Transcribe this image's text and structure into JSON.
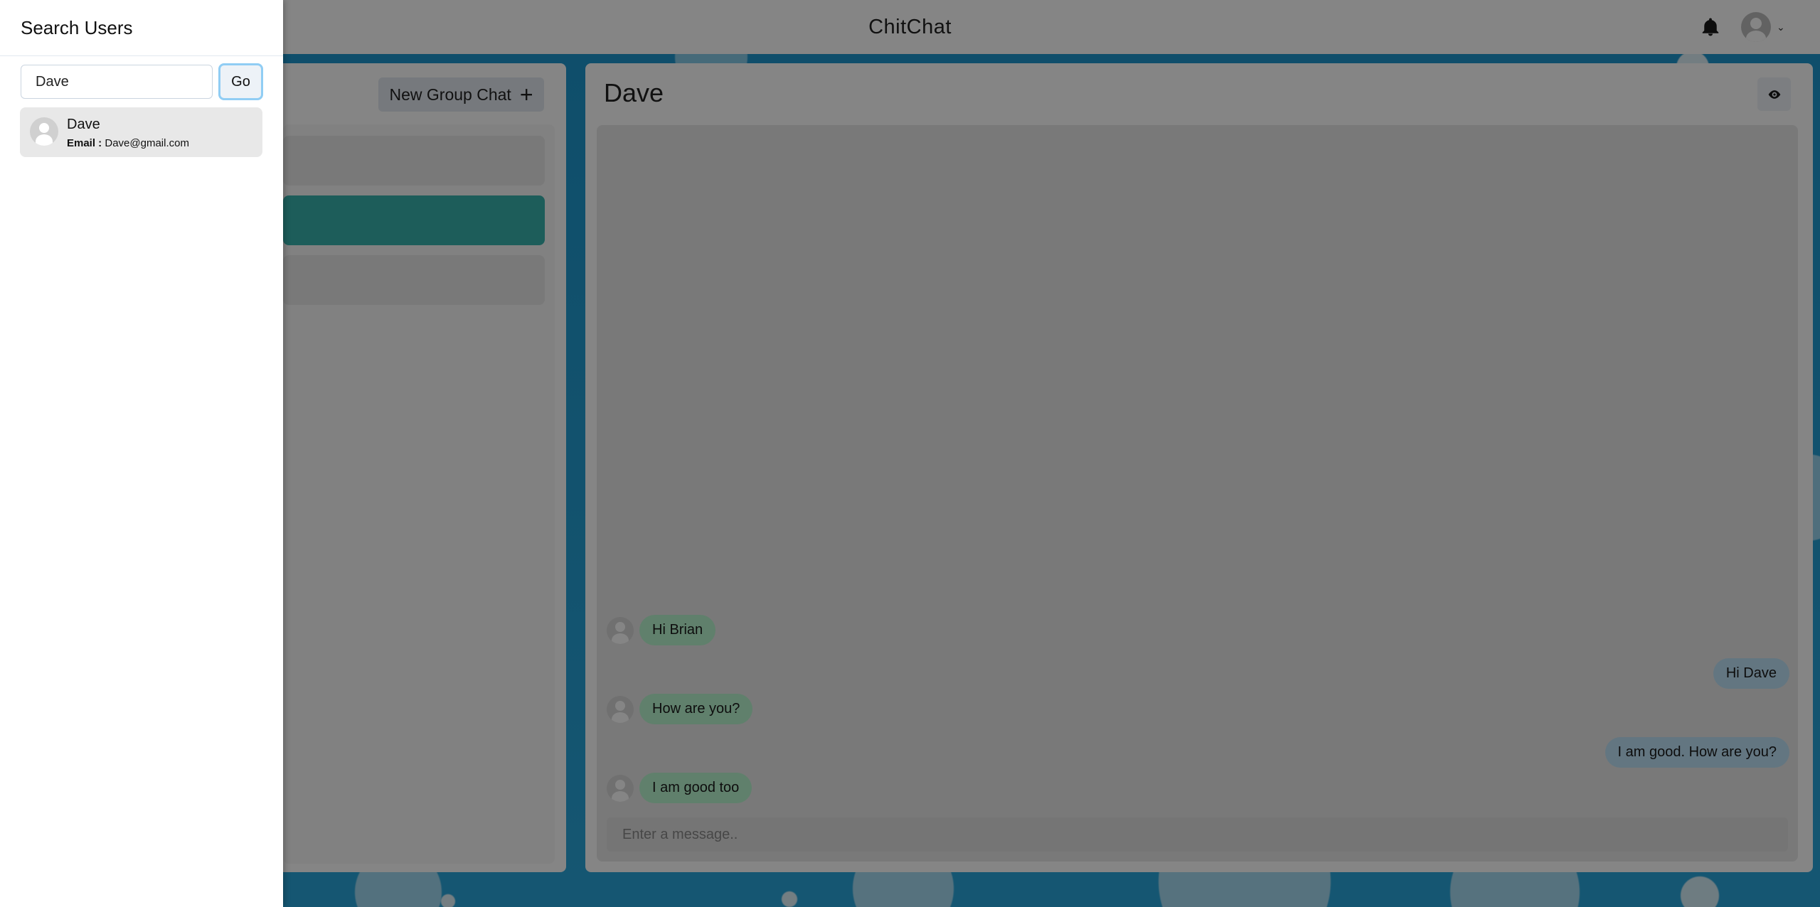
{
  "header": {
    "title": "ChitChat"
  },
  "chats": {
    "new_group_label": "New Group Chat",
    "new_group_icon": "+"
  },
  "conversation": {
    "title": "Dave",
    "messages": [
      {
        "text": "Hi Brian",
        "direction": "in"
      },
      {
        "text": "Hi Dave",
        "direction": "out"
      },
      {
        "text": "How are you?",
        "direction": "in"
      },
      {
        "text": "I am good. How are you?",
        "direction": "out"
      },
      {
        "text": "I am good too",
        "direction": "in"
      }
    ],
    "input_placeholder": "Enter a message.."
  },
  "drawer": {
    "title": "Search Users",
    "search_value": "Dave",
    "go_label": "Go",
    "results": [
      {
        "name": "Dave",
        "email_label": "Email :",
        "email": "Dave@gmail.com"
      }
    ]
  },
  "colors": {
    "active_chat": "#38b2ac",
    "incoming_bubble": "#b9f5d0",
    "outgoing_bubble": "#bee3f8",
    "focus_ring": "#90cdf4"
  },
  "icons": [
    "bell-icon",
    "avatar-icon",
    "chevron-down-icon",
    "plus-icon",
    "eye-icon"
  ]
}
